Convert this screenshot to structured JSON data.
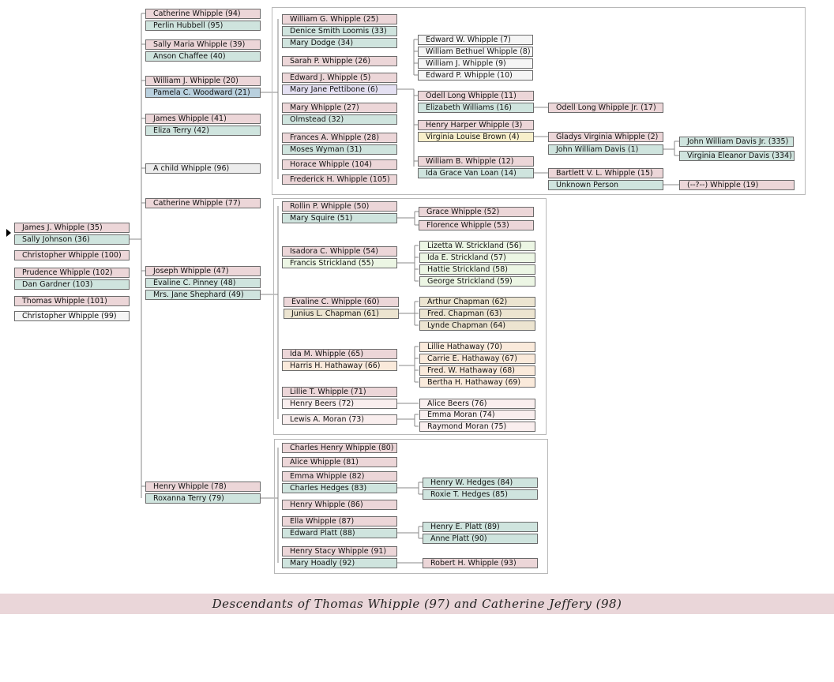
{
  "title": "Descendants of Thomas Whipple (97) and Catherine Jeffery (98)",
  "colors": {
    "male": "#ecd6d8",
    "female": "#cfe4de",
    "selected": "#b9d0de",
    "unknown": "#ececec"
  },
  "people": {
    "p35": "James J. Whipple (35)",
    "p36": "Sally Johnson (36)",
    "p100": "Christopher Whipple (100)",
    "p102": "Prudence Whipple (102)",
    "p103": "Dan Gardner (103)",
    "p101": "Thomas Whipple (101)",
    "p99": "Christopher Whipple (99)",
    "p94": "Catherine Whipple (94)",
    "p95": "Perlin Hubbell (95)",
    "p39": "Sally Maria Whipple (39)",
    "p40": "Anson Chaffee (40)",
    "p20": "William J. Whipple (20)",
    "p21": "Pamela C. Woodward (21)",
    "p41": "James Whipple (41)",
    "p42": "Eliza Terry (42)",
    "p96": "A child Whipple (96)",
    "p77": "Catherine Whipple (77)",
    "p47": "Joseph Whipple (47)",
    "p48": "Evaline C. Pinney (48)",
    "p49": "Mrs. Jane Shephard (49)",
    "p78": "Henry Whipple (78)",
    "p79": "Roxanna Terry (79)",
    "p25": "William G. Whipple (25)",
    "p33": "Denice Smith Loomis (33)",
    "p34": "Mary Dodge (34)",
    "p26": "Sarah P. Whipple (26)",
    "p5": "Edward J. Whipple (5)",
    "p6": "Mary Jane Pettibone (6)",
    "p27": "Mary Whipple (27)",
    "p32": "Olmstead (32)",
    "p28": "Frances A. Whipple (28)",
    "p31": "Moses Wyman (31)",
    "p104": "Horace Whipple (104)",
    "p105": "Frederick H. Whipple (105)",
    "p7": "Edward W. Whipple (7)",
    "p8": "William Bethuel Whipple (8)",
    "p9": "William J. Whipple (9)",
    "p10": "Edward P. Whipple (10)",
    "p11": "Odell Long Whipple (11)",
    "p16": "Elizabeth Williams (16)",
    "p17": "Odell Long Whipple Jr. (17)",
    "p3": "Henry Harper Whipple (3)",
    "p4": "Virginia Louise Brown (4)",
    "p2": "Gladys Virginia Whipple (2)",
    "p1": "John William Davis (1)",
    "p335": "John William Davis Jr. (335)",
    "p334": "Virginia Eleanor Davis (334)",
    "p12": "William B. Whipple (12)",
    "p14": "Ida Grace Van Loan (14)",
    "p15": "Bartlett V. L. Whipple (15)",
    "punk": "Unknown Person",
    "p19": "(--?--) Whipple (19)",
    "p50": "Rollin P. Whipple (50)",
    "p51": "Mary Squire (51)",
    "p52": "Grace Whipple (52)",
    "p53": "Florence Whipple (53)",
    "p54": "Isadora C. Whipple (54)",
    "p55": "Francis Strickland (55)",
    "p56": "Lizetta W. Strickland (56)",
    "p57": "Ida E. Strickland (57)",
    "p58": "Hattie Strickland (58)",
    "p59": "George Strickland (59)",
    "p60": "Evaline C. Whipple (60)",
    "p61": "Junius L. Chapman (61)",
    "p62": "Arthur Chapman (62)",
    "p63": "Fred. Chapman (63)",
    "p64": "Lynde Chapman (64)",
    "p65": "Ida M. Whipple (65)",
    "p66": "Harris H. Hathaway (66)",
    "p70": "Lillie Hathaway (70)",
    "p67": "Carrie E. Hathaway (67)",
    "p68": "Fred. W. Hathaway (68)",
    "p69": "Bertha H. Hathaway (69)",
    "p71": "Lillie T. Whipple (71)",
    "p72": "Henry Beers (72)",
    "p76": "Alice Beers (76)",
    "p73": "Lewis A. Moran (73)",
    "p74": "Emma Moran (74)",
    "p75": "Raymond Moran (75)",
    "p80": "Charles Henry Whipple (80)",
    "p81": "Alice Whipple (81)",
    "p82": "Emma Whipple (82)",
    "p83": "Charles Hedges (83)",
    "p84": "Henry W. Hedges (84)",
    "p85": "Roxie T. Hedges (85)",
    "p86": "Henry Whipple (86)",
    "p87": "Ella Whipple (87)",
    "p88": "Edward Platt (88)",
    "p89": "Henry E. Platt (89)",
    "p90": "Anne Platt (90)",
    "p91": "Henry Stacy Whipple (91)",
    "p92": "Mary Hoadly (92)",
    "p93": "Robert H. Whipple (93)"
  }
}
